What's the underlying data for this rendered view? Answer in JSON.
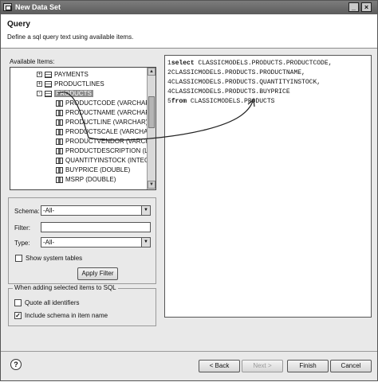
{
  "window": {
    "title": "New Data Set"
  },
  "header": {
    "title": "Query",
    "subtitle": "Define a sql query text using available items."
  },
  "available": {
    "label": "Available Items:",
    "tables": [
      {
        "name": "PAYMENTS",
        "expander": "+"
      },
      {
        "name": "PRODUCTLINES",
        "expander": "+"
      },
      {
        "name": "PRODUCTS",
        "expander": "-"
      }
    ],
    "columns": [
      "PRODUCTCODE (VARCHAR)",
      "PRODUCTNAME (VARCHAR)",
      "PRODUCTLINE (VARCHAR)",
      "PRODUCTSCALE (VARCHAR)",
      "PRODUCTVENDOR (VARCHAR)",
      "PRODUCTDESCRIPTION (LONGVARCHAR)",
      "QUANTITYINSTOCK (INTEGER)",
      "BUYPRICE (DOUBLE)",
      "MSRP (DOUBLE)"
    ]
  },
  "filter": {
    "schema_label": "Schema:",
    "schema_value": "-All-",
    "filter_label": "Filter:",
    "filter_value": "",
    "type_label": "Type:",
    "type_value": "-All-",
    "show_system_tables": "Show system tables",
    "show_system_tables_checked": false,
    "apply_label": "Apply Filter"
  },
  "sql_options": {
    "title": "When adding selected items to SQL",
    "quote_label": "Quote all identifiers",
    "quote_checked": false,
    "include_schema_label": "Include schema in item name",
    "include_schema_checked": true
  },
  "editor": {
    "lines": [
      {
        "n": "1",
        "kw": "select",
        "text": " CLASSICMODELS.PRODUCTS.PRODUCTCODE,"
      },
      {
        "n": "2",
        "kw": "",
        "text": "CLASSICMODELS.PRODUCTS.PRODUCTNAME,"
      },
      {
        "n": "4",
        "kw": "",
        "text": "CLASSICMODELS.PRODUCTS.QUANTITYINSTOCK,"
      },
      {
        "n": "4",
        "kw": "",
        "text": "CLASSICMODELS.PRODUCTS.BUYPRICE"
      },
      {
        "n": "5",
        "kw": "from",
        "text": " CLASSICMODELS.PRODUCTS"
      }
    ]
  },
  "buttons": {
    "back": "< Back",
    "next": "Next >",
    "finish": "Finish",
    "cancel": "Cancel"
  },
  "icons": {
    "help": "?"
  }
}
